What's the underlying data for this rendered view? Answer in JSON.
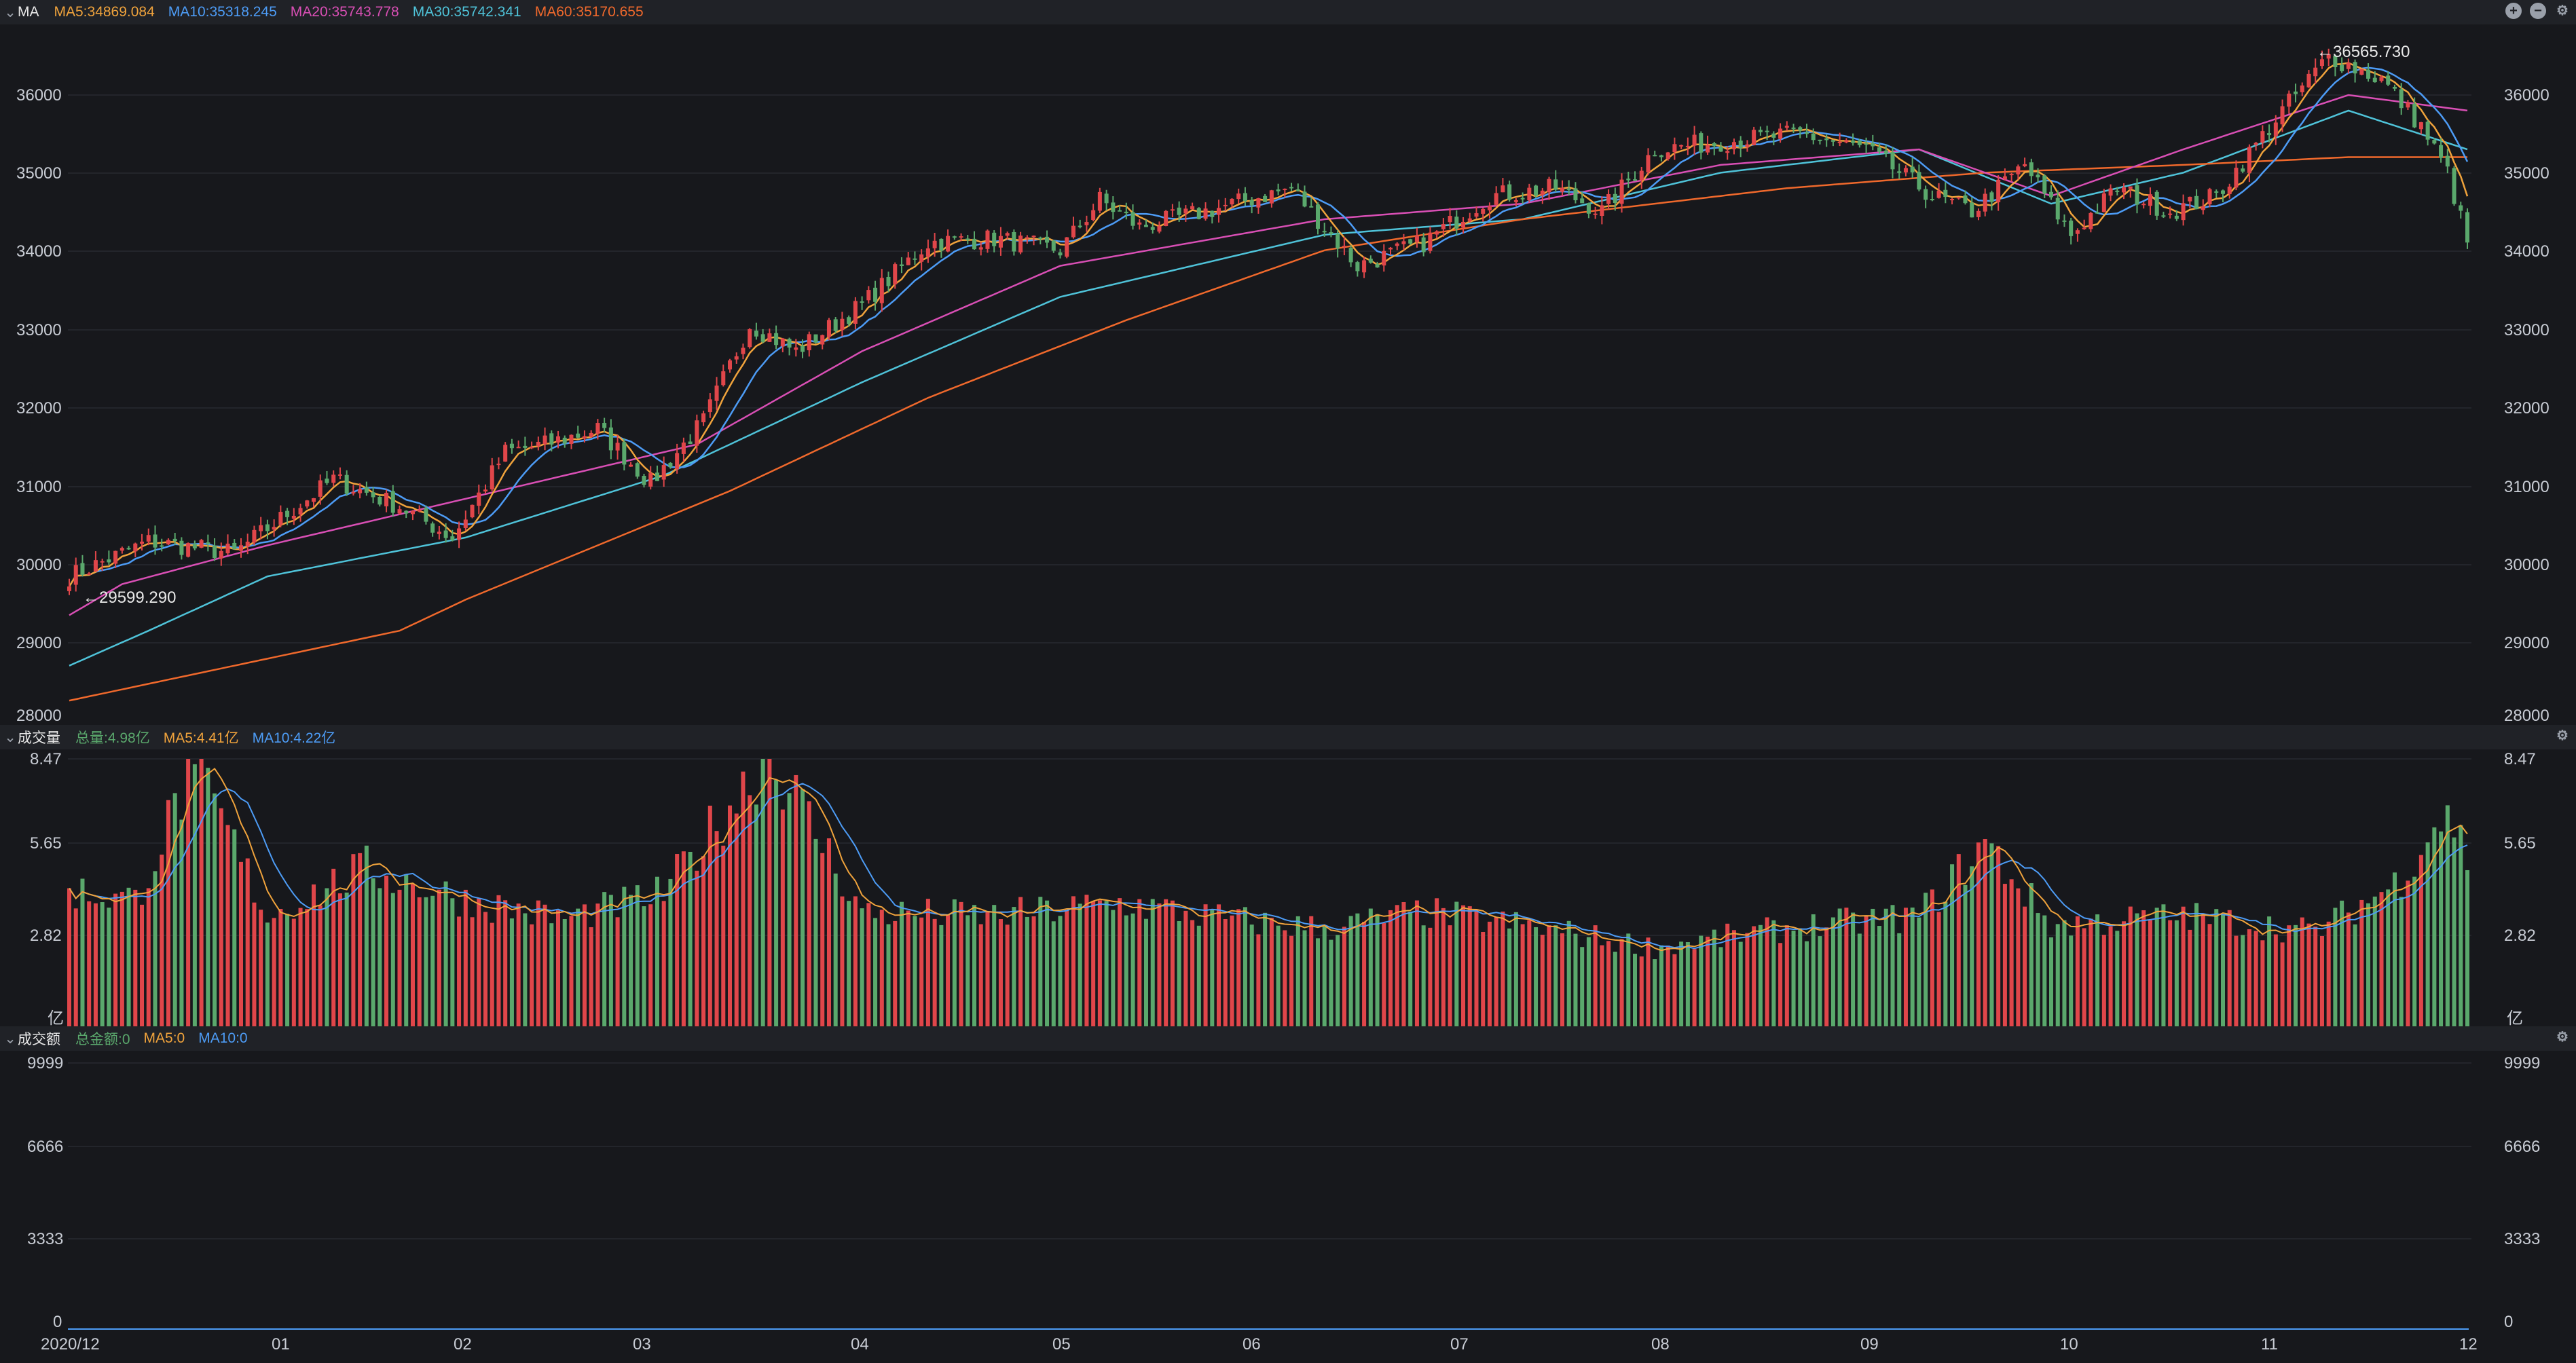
{
  "price_panel": {
    "title": "MA",
    "legend": [
      {
        "text": "MA5:34869.084",
        "color": "#f0a33c"
      },
      {
        "text": "MA10:35318.245",
        "color": "#4d9cf6"
      },
      {
        "text": "MA20:35743.778",
        "color": "#d94fb5"
      },
      {
        "text": "MA30:35742.341",
        "color": "#4fc3d9"
      },
      {
        "text": "MA60:35170.655",
        "color": "#f0692c"
      }
    ],
    "high_label": "←36565.730",
    "low_label": "←29599.290",
    "y_ticks": [
      "36000",
      "35000",
      "34000",
      "33000",
      "32000",
      "31000",
      "30000",
      "29000",
      "28000"
    ]
  },
  "volume_panel": {
    "title": "成交量",
    "legend": [
      {
        "text": "总量:4.98亿",
        "color": "#5aa86c"
      },
      {
        "text": "MA5:4.41亿",
        "color": "#f0a33c"
      },
      {
        "text": "MA10:4.22亿",
        "color": "#4d9cf6"
      }
    ],
    "y_ticks": [
      "8.47",
      "5.65",
      "2.82",
      "亿"
    ]
  },
  "amount_panel": {
    "title": "成交额",
    "legend": [
      {
        "text": "总金额:0",
        "color": "#5aa86c"
      },
      {
        "text": "MA5:0",
        "color": "#f0a33c"
      },
      {
        "text": "MA10:0",
        "color": "#4d9cf6"
      }
    ],
    "y_ticks": [
      "9999",
      "6666",
      "3333",
      "0"
    ]
  },
  "x_axis_labels": [
    "2020/12",
    "01",
    "02",
    "03",
    "04",
    "05",
    "06",
    "07",
    "08",
    "09",
    "10",
    "11",
    "12"
  ],
  "colors": {
    "up": "#e0464a",
    "down": "#5aa86c",
    "background": "#17181c",
    "panel_header": "#202227"
  },
  "chart_data": [
    {
      "type": "candlestick",
      "title": "",
      "ylim": [
        28000,
        36900
      ],
      "close_anchors": [
        [
          0,
          29800
        ],
        [
          12,
          30250
        ],
        [
          25,
          30100
        ],
        [
          40,
          31050
        ],
        [
          50,
          30700
        ],
        [
          58,
          30300
        ],
        [
          66,
          31400
        ],
        [
          72,
          31500
        ],
        [
          80,
          31700
        ],
        [
          88,
          31000
        ],
        [
          96,
          31800
        ],
        [
          103,
          33050
        ],
        [
          110,
          32700
        ],
        [
          120,
          33300
        ],
        [
          130,
          34100
        ],
        [
          140,
          34150
        ],
        [
          150,
          34000
        ],
        [
          156,
          34650
        ],
        [
          162,
          34300
        ],
        [
          172,
          34500
        ],
        [
          185,
          34800
        ],
        [
          195,
          33800
        ],
        [
          205,
          34100
        ],
        [
          215,
          34700
        ],
        [
          225,
          34800
        ],
        [
          232,
          34500
        ],
        [
          240,
          35300
        ],
        [
          250,
          35400
        ],
        [
          262,
          35500
        ],
        [
          272,
          35300
        ],
        [
          282,
          34700
        ],
        [
          288,
          34500
        ],
        [
          296,
          35100
        ],
        [
          303,
          34200
        ],
        [
          310,
          34800
        ],
        [
          318,
          34500
        ],
        [
          325,
          34700
        ],
        [
          335,
          35800
        ],
        [
          342,
          36500
        ],
        [
          350,
          36200
        ],
        [
          356,
          35600
        ],
        [
          360,
          35000
        ],
        [
          363,
          34100
        ]
      ],
      "ma_series": [
        {
          "name": "MA30",
          "color": "#4fc3d9",
          "points": [
            [
              0,
              28650
            ],
            [
              12,
              29100
            ],
            [
              30,
              29800
            ],
            [
              60,
              30300
            ],
            [
              90,
              31100
            ],
            [
              120,
              32300
            ],
            [
              150,
              33400
            ],
            [
              190,
              34200
            ],
            [
              220,
              34400
            ],
            [
              250,
              35000
            ],
            [
              280,
              35300
            ],
            [
              300,
              34600
            ],
            [
              320,
              35000
            ],
            [
              345,
              35800
            ],
            [
              363,
              35300
            ]
          ]
        },
        {
          "name": "MA60",
          "color": "#f0692c",
          "points": [
            [
              0,
              28200
            ],
            [
              50,
              29100
            ],
            [
              60,
              29500
            ],
            [
              100,
              30900
            ],
            [
              130,
              32100
            ],
            [
              160,
              33100
            ],
            [
              190,
              34000
            ],
            [
              220,
              34400
            ],
            [
              260,
              34800
            ],
            [
              290,
              35000
            ],
            [
              320,
              35100
            ],
            [
              345,
              35200
            ],
            [
              363,
              35200
            ]
          ]
        },
        {
          "name": "MA20",
          "color": "#d94fb5",
          "points": [
            [
              0,
              29300
            ],
            [
              8,
              29700
            ],
            [
              30,
              30200
            ],
            [
              60,
              30800
            ],
            [
              95,
              31500
            ],
            [
              120,
              32700
            ],
            [
              150,
              33800
            ],
            [
              190,
              34400
            ],
            [
              220,
              34600
            ],
            [
              250,
              35100
            ],
            [
              280,
              35300
            ],
            [
              300,
              34700
            ],
            [
              320,
              35300
            ],
            [
              345,
              36000
            ],
            [
              363,
              35800
            ]
          ]
        }
      ]
    },
    {
      "type": "bar",
      "title": "",
      "ylabel": "亿",
      "ylim": [
        0,
        8.47
      ],
      "value_anchors": [
        [
          0,
          4.3
        ],
        [
          10,
          4.0
        ],
        [
          19,
          8.3
        ],
        [
          30,
          3.5
        ],
        [
          45,
          5.0
        ],
        [
          60,
          4.0
        ],
        [
          75,
          3.4
        ],
        [
          90,
          4.2
        ],
        [
          106,
          8.7
        ],
        [
          120,
          3.6
        ],
        [
          140,
          3.5
        ],
        [
          160,
          3.9
        ],
        [
          175,
          3.4
        ],
        [
          190,
          3.1
        ],
        [
          205,
          3.6
        ],
        [
          220,
          3.2
        ],
        [
          240,
          2.5
        ],
        [
          260,
          3.1
        ],
        [
          280,
          3.5
        ],
        [
          290,
          5.8
        ],
        [
          300,
          3.2
        ],
        [
          320,
          3.5
        ],
        [
          340,
          3.0
        ],
        [
          352,
          4.5
        ],
        [
          360,
          7.0
        ],
        [
          363,
          5.3
        ]
      ],
      "ma_series": [
        {
          "name": "MA5",
          "color": "#f0a33c",
          "value": 4.41
        },
        {
          "name": "MA10",
          "color": "#4d9cf6",
          "value": 4.22
        }
      ]
    },
    {
      "type": "bar",
      "title": "",
      "ylim": [
        0,
        9999
      ],
      "values": [
        0
      ]
    }
  ]
}
